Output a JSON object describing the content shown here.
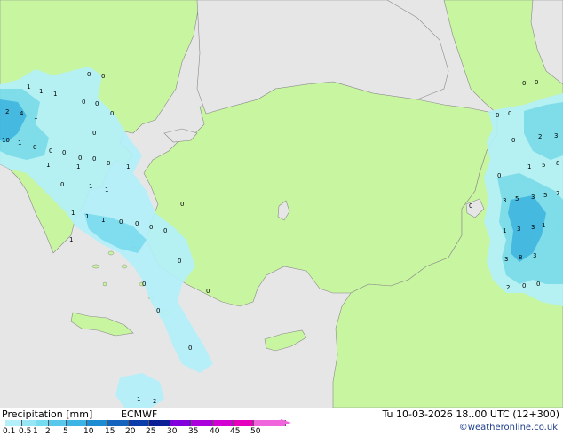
{
  "title": "Precipitation [mm]",
  "model": "ECMWF",
  "valid_time": "Tu 10-03-2026 18..00 UTC (12+300)",
  "credit": "©weatheronline.co.uk",
  "legend": {
    "ticks": [
      "0.1",
      "0.5",
      "1",
      "2",
      "5",
      "10",
      "15",
      "20",
      "25",
      "30",
      "35",
      "40",
      "45",
      "50"
    ],
    "colors": [
      "#b4f0fa",
      "#96e6f5",
      "#78dcf0",
      "#5ac8eb",
      "#3cb4e6",
      "#1e8cd2",
      "#1464be",
      "#0a3caa",
      "#0a1e96",
      "#8200dc",
      "#aa00dc",
      "#d200d2",
      "#e600be",
      "#f064dc"
    ]
  },
  "colors": {
    "sea": "#e6e6e6",
    "land": "#c8f5a0",
    "light_rain": "#b4f0fa",
    "moderate_rain": "#78dcf0",
    "heavy_rain": "#3cb4e6"
  },
  "precip_values": [
    {
      "id": "a1",
      "text": "0"
    },
    {
      "id": "a2",
      "text": "0"
    },
    {
      "id": "a3",
      "text": "1"
    },
    {
      "id": "a4",
      "text": "1"
    },
    {
      "id": "a5",
      "text": "1"
    },
    {
      "id": "a6",
      "text": "2"
    },
    {
      "id": "a7",
      "text": "4"
    },
    {
      "id": "a8",
      "text": "1"
    },
    {
      "id": "a9",
      "text": "10"
    },
    {
      "id": "a10",
      "text": "1"
    },
    {
      "id": "a11",
      "text": "0"
    },
    {
      "id": "a12",
      "text": "0"
    },
    {
      "id": "a13",
      "text": "0"
    },
    {
      "id": "a14",
      "text": "0"
    },
    {
      "id": "a15",
      "text": "0"
    },
    {
      "id": "a16",
      "text": "0"
    },
    {
      "id": "a17",
      "text": "0"
    },
    {
      "id": "a18",
      "text": "0"
    },
    {
      "id": "a19",
      "text": "0"
    },
    {
      "id": "a20",
      "text": "1"
    },
    {
      "id": "a21",
      "text": "1"
    },
    {
      "id": "a22",
      "text": "0"
    },
    {
      "id": "a23",
      "text": "1"
    },
    {
      "id": "a24",
      "text": "1"
    },
    {
      "id": "a25",
      "text": "1"
    },
    {
      "id": "a26",
      "text": "0"
    },
    {
      "id": "a27",
      "text": "1"
    },
    {
      "id": "a28",
      "text": "1"
    },
    {
      "id": "a29",
      "text": "1"
    },
    {
      "id": "a30",
      "text": "0"
    },
    {
      "id": "a31",
      "text": "0"
    },
    {
      "id": "a32",
      "text": "1"
    },
    {
      "id": "a33",
      "text": "0"
    },
    {
      "id": "a34",
      "text": "0"
    },
    {
      "id": "a35",
      "text": "0"
    },
    {
      "id": "a36",
      "text": "0"
    },
    {
      "id": "a37",
      "text": "0"
    },
    {
      "id": "a38",
      "text": "0"
    },
    {
      "id": "a39",
      "text": "0"
    },
    {
      "id": "a40",
      "text": "0"
    },
    {
      "id": "a41",
      "text": "1"
    },
    {
      "id": "a42",
      "text": "2"
    },
    {
      "id": "b1",
      "text": "0"
    },
    {
      "id": "b2",
      "text": "0"
    },
    {
      "id": "b3",
      "text": "0"
    },
    {
      "id": "b4",
      "text": "0"
    },
    {
      "id": "b5",
      "text": "0"
    },
    {
      "id": "b6",
      "text": "2"
    },
    {
      "id": "b7",
      "text": "3"
    },
    {
      "id": "b8",
      "text": "1"
    },
    {
      "id": "b9",
      "text": "5"
    },
    {
      "id": "b10",
      "text": "8"
    },
    {
      "id": "b11",
      "text": "0"
    },
    {
      "id": "b12",
      "text": "0"
    },
    {
      "id": "b13",
      "text": "3"
    },
    {
      "id": "b14",
      "text": "5"
    },
    {
      "id": "b15",
      "text": "3"
    },
    {
      "id": "b16",
      "text": "5"
    },
    {
      "id": "b17",
      "text": "7"
    },
    {
      "id": "b18",
      "text": "1"
    },
    {
      "id": "b19",
      "text": "3"
    },
    {
      "id": "b20",
      "text": "3"
    },
    {
      "id": "b21",
      "text": "1"
    },
    {
      "id": "b22",
      "text": "3"
    },
    {
      "id": "b23",
      "text": "8"
    },
    {
      "id": "b24",
      "text": "3"
    },
    {
      "id": "b25",
      "text": "2"
    },
    {
      "id": "b26",
      "text": "0"
    },
    {
      "id": "b27",
      "text": "0"
    }
  ]
}
